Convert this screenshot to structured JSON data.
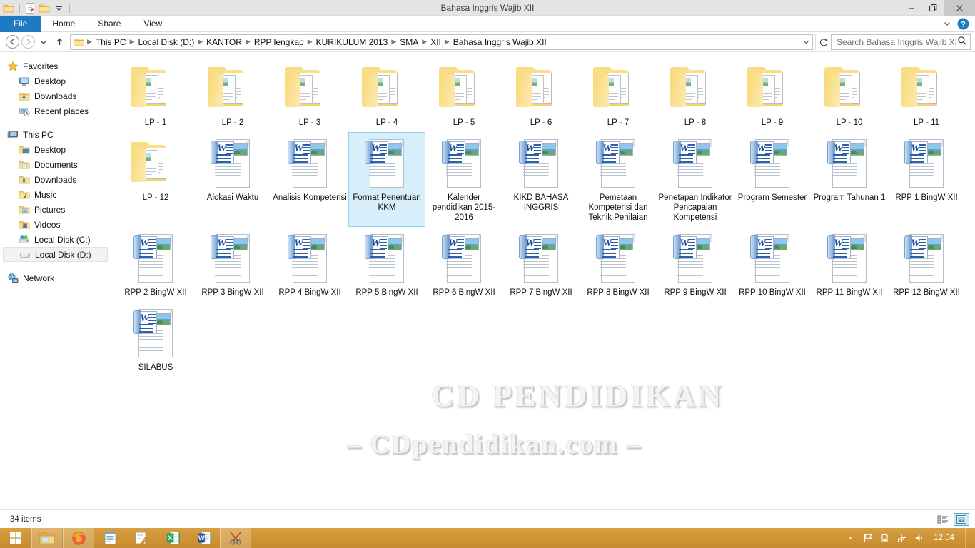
{
  "window": {
    "title": "Bahasa Inggris Wajib XII",
    "quick_access": [
      "folder-icon",
      "properties-icon",
      "new-folder-icon",
      "chevron-down-icon"
    ],
    "controls": {
      "minimize": "minimize-icon",
      "restore": "restore-icon",
      "close": "close-icon"
    }
  },
  "ribbon": {
    "tabs": [
      {
        "label": "File",
        "active": true
      },
      {
        "label": "Home",
        "active": false
      },
      {
        "label": "Share",
        "active": false
      },
      {
        "label": "View",
        "active": false
      }
    ],
    "help_icon": "help-icon",
    "expand_icon": "chevron-down-icon"
  },
  "addressbar": {
    "back_icon": "back-arrow-icon",
    "forward_icon": "forward-arrow-icon",
    "recent_icon": "chevron-down-icon",
    "up_icon": "up-arrow-icon",
    "crumbs": [
      "This PC",
      "Local Disk (D:)",
      "KANTOR",
      "RPP lengkap",
      "KURIKULUM 2013",
      "SMA",
      "XII",
      "Bahasa Inggris Wajib XII"
    ],
    "dropdown_icon": "chevron-down-icon",
    "refresh_icon": "refresh-icon"
  },
  "search": {
    "placeholder": "Search Bahasa Inggris Wajib XII",
    "value": "",
    "icon": "search-icon"
  },
  "navpane": {
    "groups": [
      {
        "header": {
          "label": "Favorites",
          "icon": "star-icon"
        },
        "items": [
          {
            "label": "Desktop",
            "icon": "desktop-icon"
          },
          {
            "label": "Downloads",
            "icon": "downloads-folder-icon"
          },
          {
            "label": "Recent places",
            "icon": "recent-places-icon"
          }
        ]
      },
      {
        "header": {
          "label": "This PC",
          "icon": "computer-icon"
        },
        "items": [
          {
            "label": "Desktop",
            "icon": "desktop-folder-icon"
          },
          {
            "label": "Documents",
            "icon": "documents-folder-icon"
          },
          {
            "label": "Downloads",
            "icon": "downloads-folder-icon"
          },
          {
            "label": "Music",
            "icon": "music-folder-icon"
          },
          {
            "label": "Pictures",
            "icon": "pictures-folder-icon"
          },
          {
            "label": "Videos",
            "icon": "videos-folder-icon"
          },
          {
            "label": "Local Disk (C:)",
            "icon": "system-drive-icon"
          },
          {
            "label": "Local Disk (D:)",
            "icon": "drive-icon",
            "selected": true
          }
        ]
      },
      {
        "header": {
          "label": "Network",
          "icon": "network-icon"
        },
        "items": []
      }
    ]
  },
  "files": [
    {
      "name": "LP - 1",
      "type": "folder"
    },
    {
      "name": "LP - 2",
      "type": "folder"
    },
    {
      "name": "LP - 3",
      "type": "folder"
    },
    {
      "name": "LP - 4",
      "type": "folder"
    },
    {
      "name": "LP - 5",
      "type": "folder"
    },
    {
      "name": "LP - 6",
      "type": "folder"
    },
    {
      "name": "LP - 7",
      "type": "folder"
    },
    {
      "name": "LP - 8",
      "type": "folder"
    },
    {
      "name": "LP - 9",
      "type": "folder"
    },
    {
      "name": "LP - 10",
      "type": "folder"
    },
    {
      "name": "LP - 11",
      "type": "folder"
    },
    {
      "name": "LP - 12",
      "type": "folder"
    },
    {
      "name": "Alokasi Waktu",
      "type": "word"
    },
    {
      "name": "Analisis Kompetensi",
      "type": "word"
    },
    {
      "name": "Format Penentuan KKM",
      "type": "word",
      "selected": true
    },
    {
      "name": "Kalender pendidikan 2015-2016",
      "type": "word"
    },
    {
      "name": "KIKD BAHASA INGGRIS",
      "type": "word"
    },
    {
      "name": "Pemetaan Kompetensi dan Teknik Penilaian",
      "type": "word"
    },
    {
      "name": "Penetapan Indikator Pencapaian Kompetensi",
      "type": "word"
    },
    {
      "name": "Program Semester",
      "type": "word"
    },
    {
      "name": "Program Tahunan 1",
      "type": "word"
    },
    {
      "name": "RPP 1 BingW XII",
      "type": "word"
    },
    {
      "name": "RPP 2 BingW XII",
      "type": "word"
    },
    {
      "name": "RPP 3 BingW XII",
      "type": "word"
    },
    {
      "name": "RPP 4 BingW XII",
      "type": "word"
    },
    {
      "name": "RPP 5 BingW XII",
      "type": "word"
    },
    {
      "name": "RPP 6 BingW XII",
      "type": "word"
    },
    {
      "name": "RPP 7 BingW XII",
      "type": "word"
    },
    {
      "name": "RPP 8 BingW XII",
      "type": "word"
    },
    {
      "name": "RPP 9 BingW XII",
      "type": "word"
    },
    {
      "name": "RPP 10 BingW XII",
      "type": "word"
    },
    {
      "name": "RPP 11 BingW XII",
      "type": "word"
    },
    {
      "name": "RPP 12 BingW XII",
      "type": "word"
    },
    {
      "name": "SILABUS",
      "type": "word"
    }
  ],
  "watermark": {
    "line1": "CD PENDIDIKAN",
    "line2": "–  CDpendidikan.com  –"
  },
  "statusbar": {
    "item_count": "34 items",
    "views": [
      {
        "name": "details-view",
        "active": false
      },
      {
        "name": "large-icons-view",
        "active": true
      }
    ]
  },
  "taskbar": {
    "start": "windows-start-icon",
    "apps": [
      {
        "name": "file-explorer",
        "icon": "folder-icon",
        "open": true
      },
      {
        "name": "firefox",
        "icon": "firefox-icon",
        "open": true
      },
      {
        "name": "notepad",
        "icon": "notepad-icon",
        "open": false
      },
      {
        "name": "wordpad",
        "icon": "wordpad-icon",
        "open": false
      },
      {
        "name": "excel",
        "icon": "excel-icon",
        "open": false
      },
      {
        "name": "word",
        "icon": "word-icon",
        "open": false
      },
      {
        "name": "snipping-tool",
        "icon": "snipping-tool-icon",
        "open": true
      }
    ],
    "tray": [
      {
        "name": "show-hidden-icons",
        "icon": "chevron-up-icon"
      },
      {
        "name": "action-center",
        "icon": "flag-icon"
      },
      {
        "name": "battery",
        "icon": "battery-icon"
      },
      {
        "name": "network",
        "icon": "network-icon"
      },
      {
        "name": "volume",
        "icon": "speaker-icon"
      }
    ],
    "clock": "12:04"
  },
  "colors": {
    "accent_blue": "#1e7bc0",
    "selection_blue": "#d7eefb",
    "selection_border": "#8ed0f0",
    "taskbar_gold": "#cf9638",
    "folder_yellow": "#f6d269"
  }
}
